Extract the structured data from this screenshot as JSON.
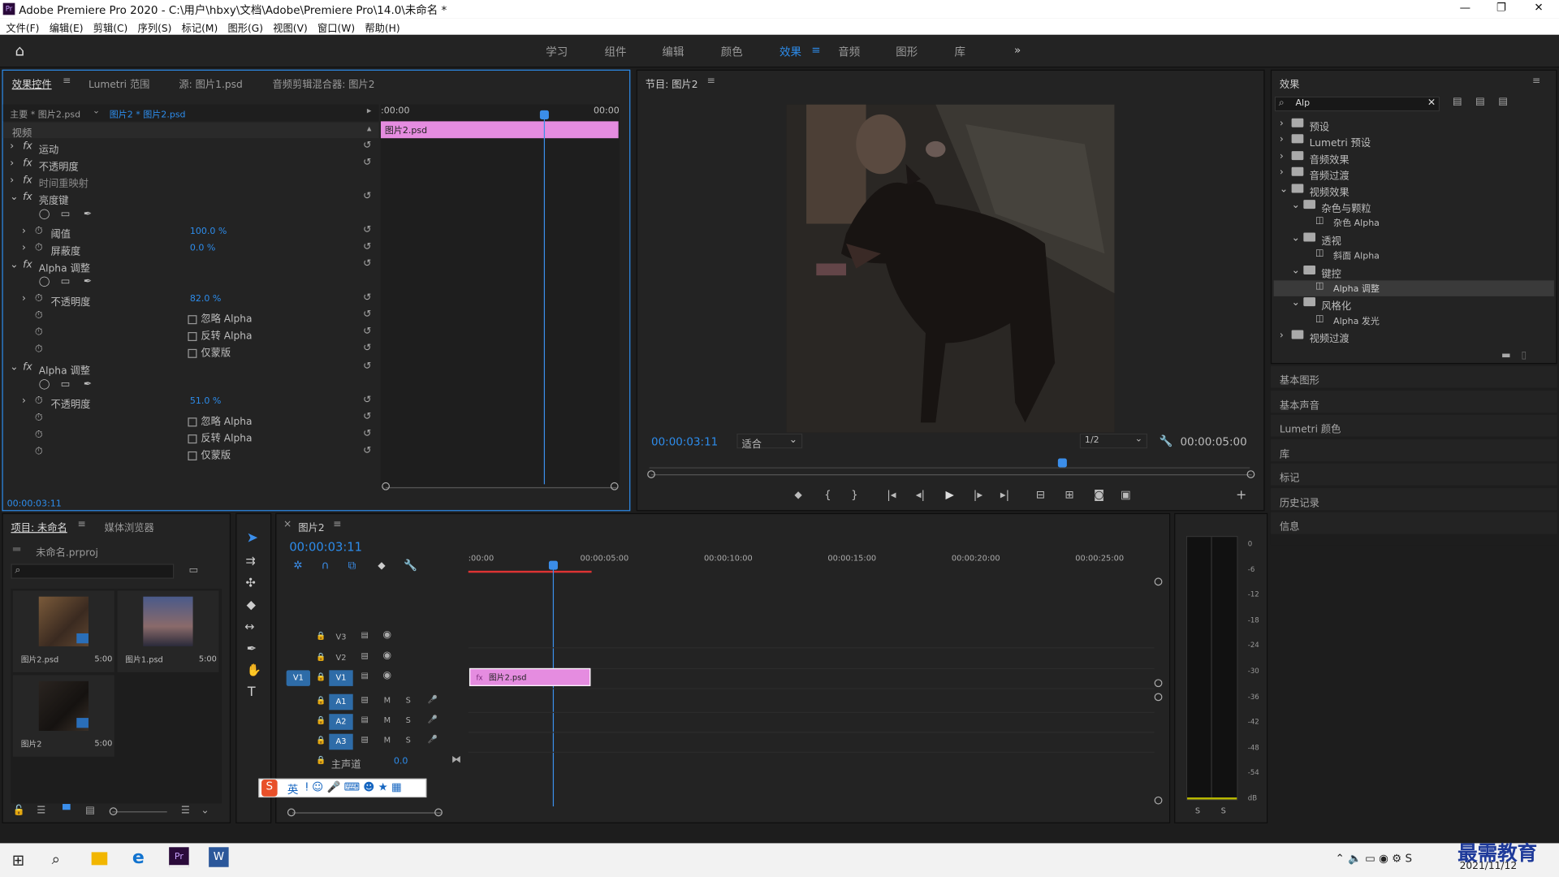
{
  "app": {
    "title": "Adobe Premiere Pro 2020 - C:\\用户\\hbxy\\文档\\Adobe\\Premiere Pro\\14.0\\未命名 *",
    "logo": "Pr"
  },
  "menu": [
    "文件(F)",
    "编辑(E)",
    "剪辑(C)",
    "序列(S)",
    "标记(M)",
    "图形(G)",
    "视图(V)",
    "窗口(W)",
    "帮助(H)"
  ],
  "workspaces": [
    "学习",
    "组件",
    "编辑",
    "颜色",
    "效果",
    "音频",
    "图形",
    "库"
  ],
  "effect_controls": {
    "tabs": [
      "效果控件",
      "Lumetri 范围",
      "源: 图片1.psd",
      "音频剪辑混合器: 图片2"
    ],
    "master": "主要 * 图片2.psd",
    "clip": "图片2 * 图片2.psd",
    "time_start": ":00:00",
    "time_end": "00:00",
    "clip_label": "图片2.psd",
    "section": "视频",
    "rows": [
      {
        "name": "运动"
      },
      {
        "name": "不透明度"
      },
      {
        "name": "时间重映射"
      },
      {
        "name": "亮度键"
      },
      {
        "name": "阈值",
        "value": "100.0 %"
      },
      {
        "name": "屏蔽度",
        "value": "0.0 %"
      },
      {
        "name": "Alpha 调整"
      },
      {
        "name": "不透明度",
        "value": "82.0 %"
      },
      {
        "name": "忽略 Alpha"
      },
      {
        "name": "反转 Alpha"
      },
      {
        "name": "仅蒙版"
      },
      {
        "name": "Alpha 调整"
      },
      {
        "name": "不透明度",
        "value": "51.0 %"
      },
      {
        "name": "忽略 Alpha"
      },
      {
        "name": "反转 Alpha"
      },
      {
        "name": "仅蒙版"
      }
    ],
    "timecode": "00:00:03:11"
  },
  "program": {
    "title": "节目: 图片2",
    "timecode": "00:00:03:11",
    "fit": "适合",
    "quality": "1/2",
    "duration": "00:00:05:00"
  },
  "effects": {
    "title": "效果",
    "search": "Alp",
    "tree": [
      {
        "label": "预设",
        "level": 0
      },
      {
        "label": "Lumetri 预设",
        "level": 0
      },
      {
        "label": "音频效果",
        "level": 0
      },
      {
        "label": "音频过渡",
        "level": 0
      },
      {
        "label": "视频效果",
        "level": 0,
        "open": true
      },
      {
        "label": "杂色与颗粒",
        "level": 1,
        "open": true
      },
      {
        "label": "杂色 Alpha",
        "level": 2
      },
      {
        "label": "透视",
        "level": 1,
        "open": true
      },
      {
        "label": "斜面 Alpha",
        "level": 2
      },
      {
        "label": "键控",
        "level": 1,
        "open": true
      },
      {
        "label": "Alpha 调整",
        "level": 2,
        "selected": true
      },
      {
        "label": "风格化",
        "level": 1,
        "open": true
      },
      {
        "label": "Alpha 发光",
        "level": 2
      },
      {
        "label": "视频过渡",
        "level": 0
      }
    ],
    "sections": [
      "基本图形",
      "基本声音",
      "Lumetri 颜色",
      "库",
      "标记",
      "历史记录",
      "信息"
    ]
  },
  "project": {
    "tabs": [
      "项目: 未命名",
      "媒体浏览器"
    ],
    "file": "未命名.prproj",
    "items": [
      {
        "name": "图片2.psd",
        "dur": "5:00"
      },
      {
        "name": "图片1.psd",
        "dur": "5:00"
      },
      {
        "name": "图片2",
        "dur": "5:00"
      }
    ]
  },
  "timeline": {
    "title": "图片2",
    "timecode": "00:00:03:11",
    "ruler": [
      ":00:00",
      "00:00:05:00",
      "00:00:10:00",
      "00:00:15:00",
      "00:00:20:00",
      "00:00:25:00"
    ],
    "video_tracks": [
      "V3",
      "V2",
      "V1"
    ],
    "audio_tracks": [
      "A1",
      "A2",
      "A3"
    ],
    "src": "V1",
    "master": "主声道",
    "master_val": "0.0",
    "clip": "图片2.psd"
  },
  "meter": {
    "scale": [
      "0",
      "-6",
      "-12",
      "-18",
      "-24",
      "-30",
      "-36",
      "-42",
      "-48",
      "-54",
      "dB"
    ],
    "solo": [
      "S",
      "S"
    ]
  },
  "ime": {
    "lang": "英"
  },
  "clock": {
    "date": "2021/11/12"
  },
  "watermark": "最需教育"
}
